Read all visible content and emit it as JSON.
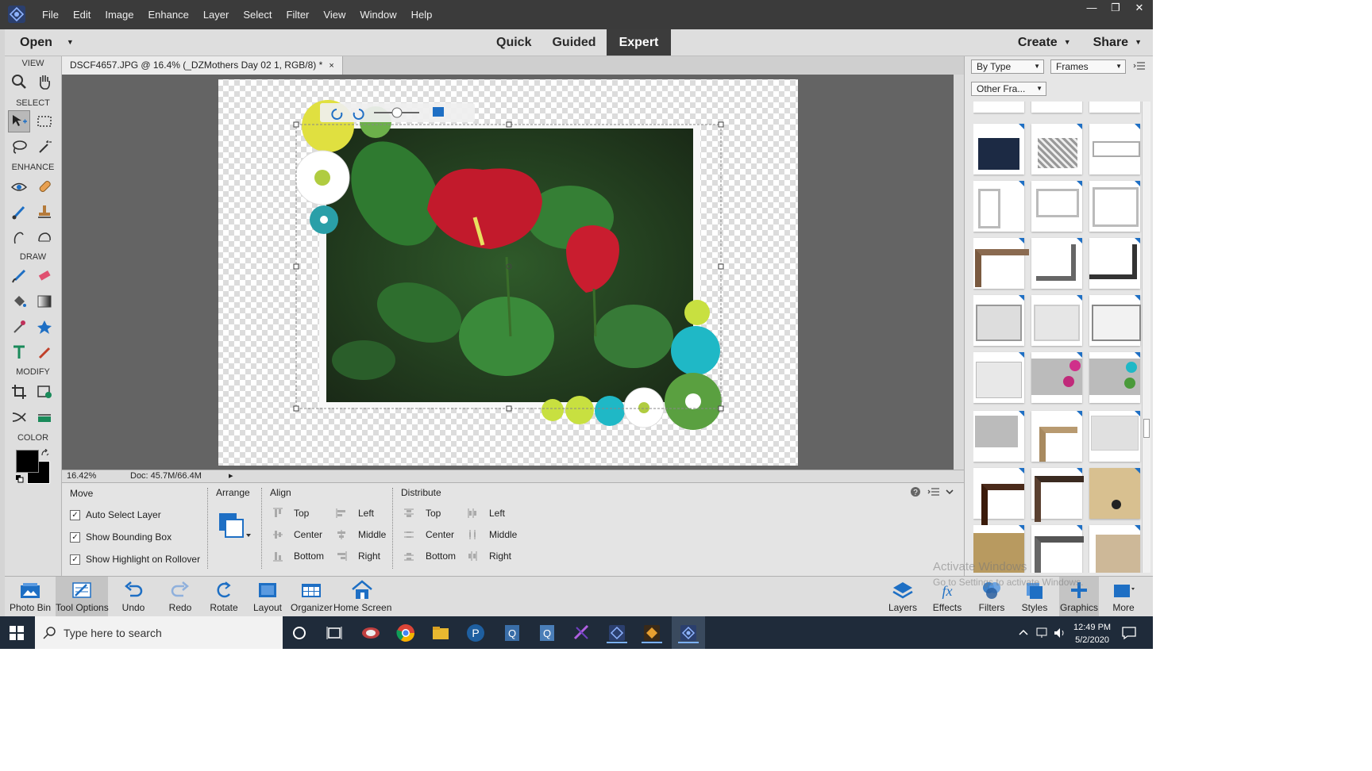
{
  "menu": [
    "File",
    "Edit",
    "Image",
    "Enhance",
    "Layer",
    "Select",
    "Filter",
    "View",
    "Window",
    "Help"
  ],
  "modebar": {
    "open": "Open",
    "tabs": [
      "Quick",
      "Guided",
      "Expert"
    ],
    "active_tab": "Expert",
    "create": "Create",
    "share": "Share"
  },
  "toolbox": {
    "sections": [
      "VIEW",
      "SELECT",
      "ENHANCE",
      "DRAW",
      "MODIFY",
      "COLOR"
    ]
  },
  "document": {
    "tab_title": "DSCF4657.JPG @ 16.4% (_DZMothers Day 02 1, RGB/8) *",
    "close": "×"
  },
  "status": {
    "zoom": "16.42%",
    "doc": "Doc: 45.7M/66.4M"
  },
  "tool_options": {
    "move_title": "Move",
    "checkboxes": [
      "Auto Select Layer",
      "Show Bounding Box",
      "Show Highlight on Rollover"
    ],
    "arrange_title": "Arrange",
    "align_title": "Align",
    "align_items": [
      "Top",
      "Center",
      "Bottom",
      "Left",
      "Middle",
      "Right"
    ],
    "distribute_title": "Distribute",
    "distribute_items": [
      "Top",
      "Center",
      "Bottom",
      "Left",
      "Middle",
      "Right"
    ]
  },
  "panel": {
    "filter1": "By Type",
    "filter2": "Frames",
    "filter3": "Other Fra..."
  },
  "bottom": [
    "Photo Bin",
    "Tool Options",
    "Undo",
    "Redo",
    "Rotate",
    "Layout",
    "Organizer",
    "Home Screen"
  ],
  "bottom_right": [
    "Layers",
    "Effects",
    "Filters",
    "Styles",
    "Graphics",
    "More"
  ],
  "watermark": {
    "line1": "Activate Windows",
    "line2": "Go to Settings to activate Windows."
  },
  "taskbar": {
    "search_placeholder": "Type here to search",
    "time": "12:49 PM",
    "date": "5/2/2020"
  },
  "colors": {
    "accent": "#1e6fc4",
    "menubar": "#3b3b3b",
    "taskbar": "#1f2b3a"
  }
}
